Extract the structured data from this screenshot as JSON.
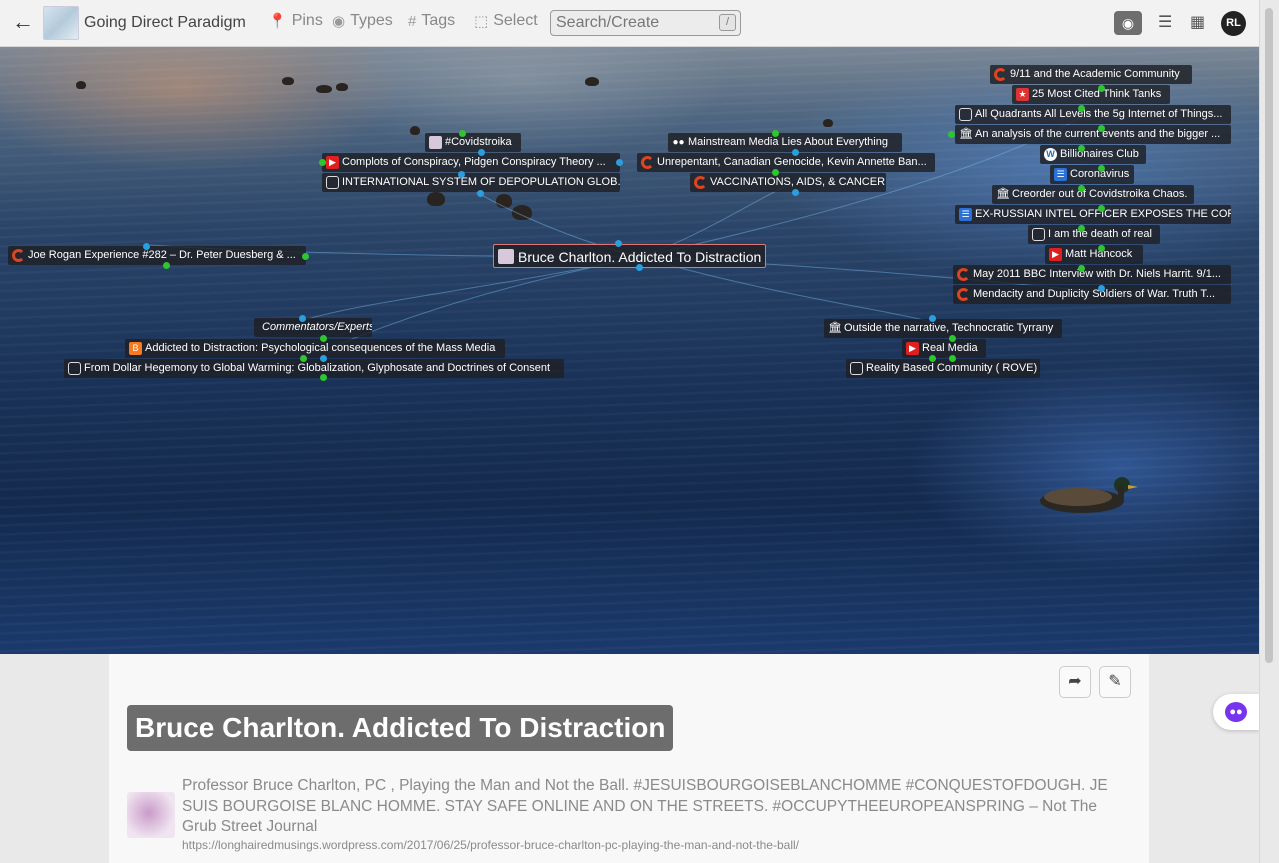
{
  "toolbar": {
    "back_icon": "arrow-left-icon",
    "app_title": "Going Direct Paradigm",
    "pins": "Pins",
    "types": "Types",
    "tags": "Tags",
    "select": "Select",
    "search_placeholder": "Search/Create",
    "search_shortcut": "/",
    "user_initials": "RL"
  },
  "map": {
    "center": "Bruce Charlton. Addicted To Distraction",
    "nodes": [
      {
        "label": "9/11 and the Academic Community"
      },
      {
        "label": "25 Most Cited Think Tanks"
      },
      {
        "label": "All Quadrants All Levels the 5g Internet of Things..."
      },
      {
        "label": "An analysis of the current events and the bigger ..."
      },
      {
        "label": "Billionaires Club"
      },
      {
        "label": "Coronavirus"
      },
      {
        "label": "Creorder out of Covidstroika Chaos."
      },
      {
        "label": "EX-RUSSIAN INTEL OFFICER EXPOSES THE CORO..."
      },
      {
        "label": "I am the death of real"
      },
      {
        "label": "Matt Hancock"
      },
      {
        "label": "May 2011 BBC Interview with Dr. Niels Harrit. 9/1..."
      },
      {
        "label": "Mendacity and Duplicity Soldiers of War. Truth T..."
      },
      {
        "label": "#Covidstroika"
      },
      {
        "label": "Complots of Conspiracy, Pidgen Conspiracy Theory ..."
      },
      {
        "label": "INTERNATIONAL SYSTEM OF DEPOPULATION GLOB..."
      },
      {
        "label": "Mainstream Media Lies About Everything"
      },
      {
        "label": "Unrepentant, Canadian Genocide, Kevin Annette Ban..."
      },
      {
        "label": "VACCINATIONS, AIDS, & CANCER"
      },
      {
        "label": "Joe Rogan Experience #282 – Dr. Peter Duesberg & ..."
      },
      {
        "label": "Commentators/Experts"
      },
      {
        "label": "Addicted to Distraction: Psychological consequences of the Mass Media"
      },
      {
        "label": "From Dollar Hegemony to Global Warming: Globalization, Glyphosate and Doctrines of Consent"
      },
      {
        "label": "Outside the narrative, Technocratic Tyrrany"
      },
      {
        "label": "Real Media"
      },
      {
        "label": "Reality Based Community ( ROVE)"
      }
    ]
  },
  "detail": {
    "title": "Bruce Charlton. Addicted To Distraction",
    "link_title": "Professor Bruce Charlton, PC , Playing the Man and Not the Ball. #JESUISBOURGOISEBLANCHOMME #CONQUESTOFDOUGH. JE SUIS BOURGOISE BLANC HOMME. STAY SAFE ONLINE AND ON THE STREETS. #OCCUPYTHEEUROPEANSPRING – Not The Grub Street Journal",
    "link_url": "https://longhairedmusings.wordpress.com/2017/06/25/professor-bruce-charlton-pc-playing-the-man-and-not-the-ball/"
  }
}
